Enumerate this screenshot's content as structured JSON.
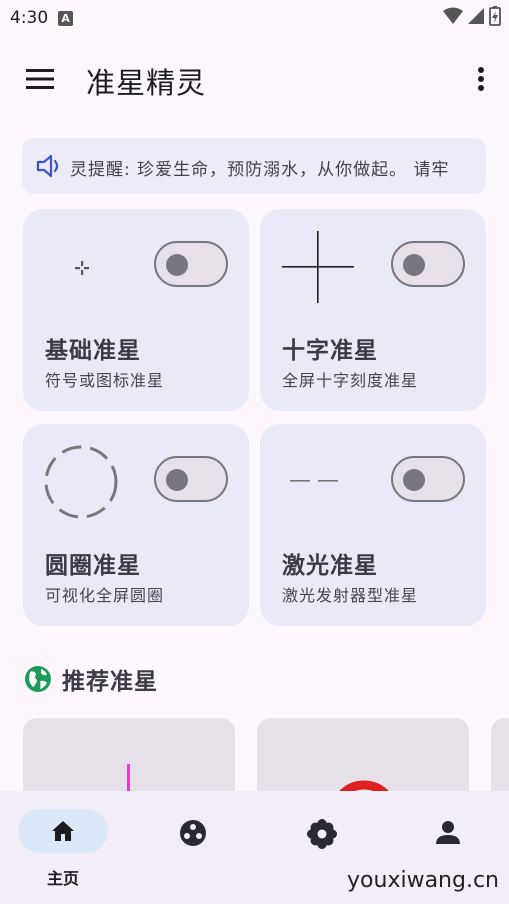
{
  "status_bar": {
    "time": "4:30",
    "notification_icon": "A"
  },
  "app_bar": {
    "title": "准星精灵",
    "menu_icon": "hamburger-menu-icon",
    "more_icon": "more-vert-icon"
  },
  "notice": {
    "icon": "speaker-icon",
    "text": "灵提醒: 珍爱生命，预防溺水，从你做起。 请牢"
  },
  "cards": [
    {
      "title": "基础准星",
      "subtitle": "符号或图标准星",
      "icon": "dot-crosshair-icon",
      "enabled": false
    },
    {
      "title": "十字准星",
      "subtitle": "全屏十字刻度准星",
      "icon": "cross-crosshair-icon",
      "enabled": false
    },
    {
      "title": "圆圈准星",
      "subtitle": "可视化全屏圆圈",
      "icon": "dashed-circle-icon",
      "enabled": false
    },
    {
      "title": "激光准星",
      "subtitle": "激光发射器型准星",
      "icon": "laser-line-icon",
      "enabled": false
    }
  ],
  "recommended": {
    "title": "推荐准星",
    "icon": "globe-icon"
  },
  "bottom_nav": {
    "items": [
      {
        "label": "主页",
        "icon": "home-icon",
        "selected": true
      },
      {
        "label": "",
        "icon": "game-icon",
        "selected": false
      },
      {
        "label": "",
        "icon": "flower-settings-icon",
        "selected": false
      },
      {
        "label": "",
        "icon": "person-icon",
        "selected": false
      }
    ]
  },
  "watermark": "youxiwang.cn",
  "colors": {
    "background": "#fdf7fd",
    "card": "#e9e9f8",
    "nav_pill": "#dbe8f8",
    "globe": "#1e9a5a",
    "laser_pink": "#e040c8",
    "red": "#e02020"
  }
}
